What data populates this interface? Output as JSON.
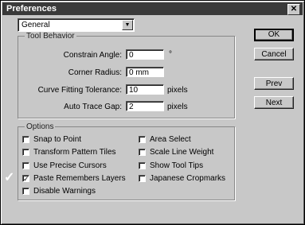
{
  "window": {
    "title": "Preferences",
    "close_icon": "close-icon"
  },
  "section_select": {
    "value": "General",
    "dropdown_icon": "chevron-down-icon"
  },
  "tool_behavior": {
    "legend": "Tool Behavior",
    "fields": [
      {
        "label": "Constrain Angle:",
        "value": "0",
        "unit": "°"
      },
      {
        "label": "Corner Radius:",
        "value": "0 mm",
        "unit": ""
      },
      {
        "label": "Curve Fitting Tolerance:",
        "value": "10",
        "unit": "pixels"
      },
      {
        "label": "Auto Trace Gap:",
        "value": "2",
        "unit": "pixels"
      }
    ]
  },
  "options": {
    "legend": "Options",
    "left": [
      {
        "label": "Snap to Point",
        "checked": false
      },
      {
        "label": "Transform Pattern Tiles",
        "checked": false
      },
      {
        "label": "Use Precise Cursors",
        "checked": false
      },
      {
        "label": "Paste Remembers Layers",
        "checked": true
      },
      {
        "label": "Disable Warnings",
        "checked": false
      }
    ],
    "right": [
      {
        "label": "Area Select",
        "checked": false
      },
      {
        "label": "Scale Line Weight",
        "checked": false
      },
      {
        "label": "Show Tool Tips",
        "checked": false
      },
      {
        "label": "Japanese Cropmarks",
        "checked": false
      }
    ]
  },
  "buttons": {
    "ok": "OK",
    "cancel": "Cancel",
    "prev": "Prev",
    "next": "Next"
  }
}
